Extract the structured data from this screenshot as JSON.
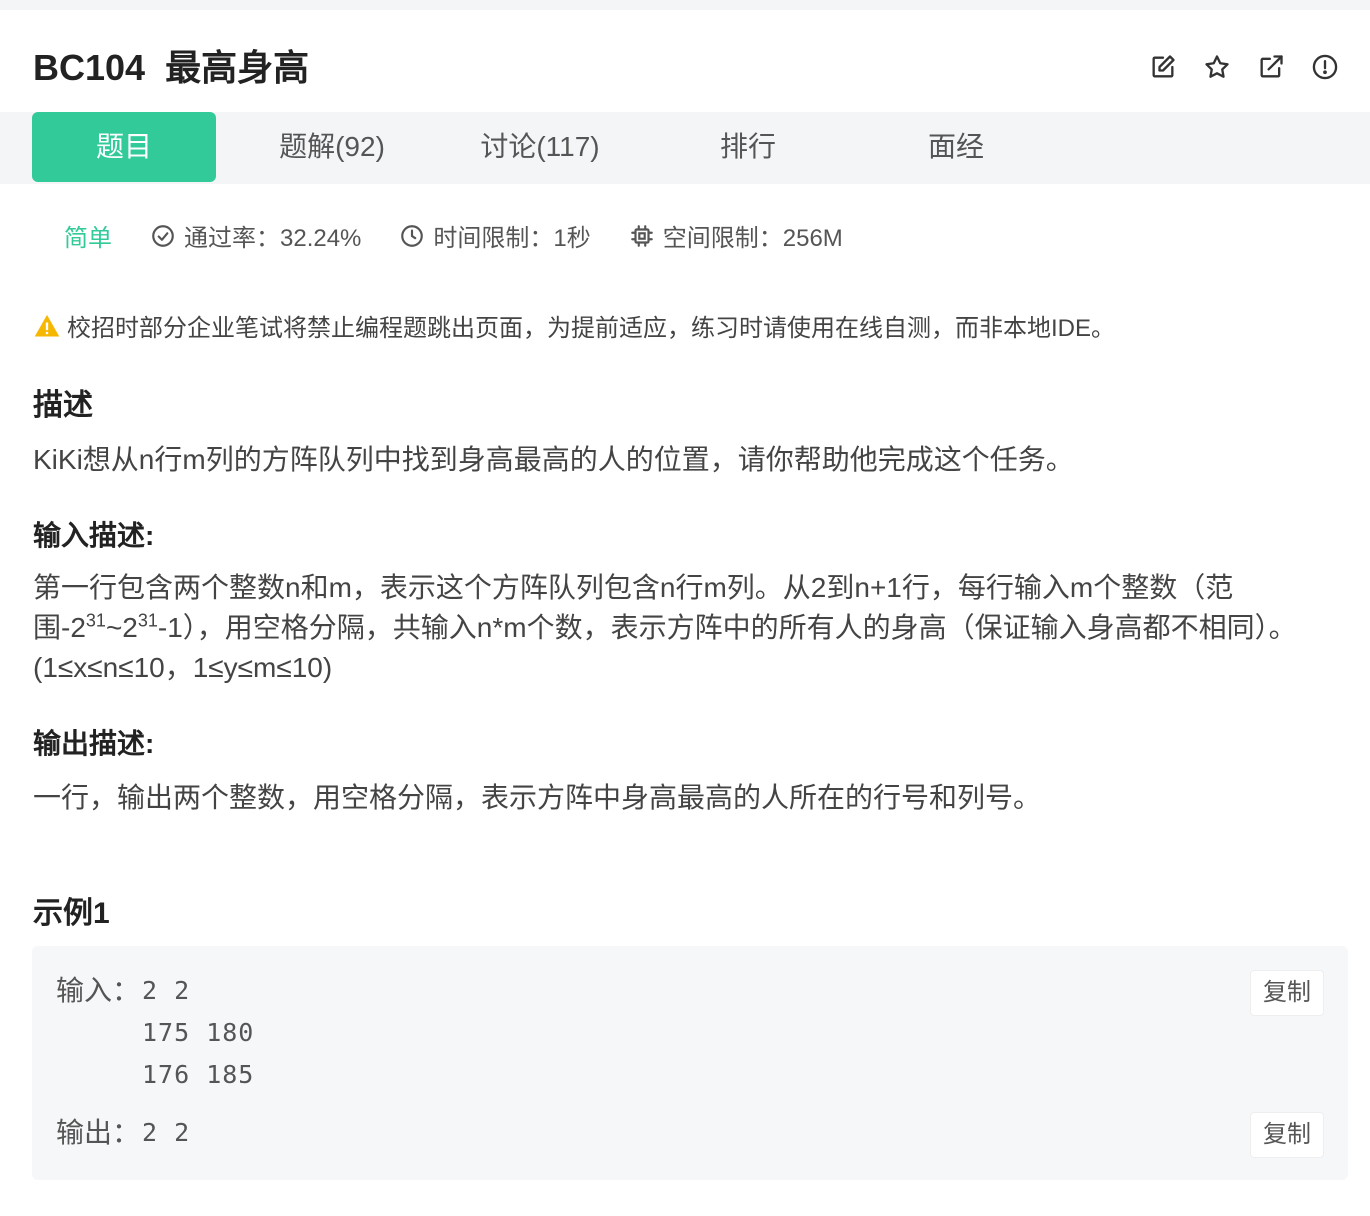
{
  "problem": {
    "id": "BC104",
    "title": "最高身高"
  },
  "actions": [
    {
      "name": "edit-icon"
    },
    {
      "name": "star-icon"
    },
    {
      "name": "share-icon"
    },
    {
      "name": "report-icon"
    }
  ],
  "tabs": [
    {
      "label": "题目",
      "active": true
    },
    {
      "label": "题解(92)",
      "active": false
    },
    {
      "label": "讨论(117)",
      "active": false
    },
    {
      "label": "排行",
      "active": false
    },
    {
      "label": "面经",
      "active": false
    }
  ],
  "meta": {
    "difficulty": "简单",
    "pass_rate": "通过率：32.24%",
    "time_limit": "时间限制：1秒",
    "space_limit": "空间限制：256M"
  },
  "warning": "校招时部分企业笔试将禁止编程题跳出页面，为提前适应，练习时请使用在线自测，而非本地IDE。",
  "description": {
    "heading": "描述",
    "text": "KiKi想从n行m列的方阵队列中找到身高最高的人的位置，请你帮助他完成这个任务。"
  },
  "input_desc": {
    "heading": "输入描述:",
    "line1": "第一行包含两个整数n和m，表示这个方阵队列包含n行m列。从2到n+1行，每行输入m个整数（范",
    "line2_a": "围-2",
    "line2_sup1": "31",
    "line2_b": "~2",
    "line2_sup2": "31",
    "line2_c": "-1），用空格分隔，共输入n*m个数，表示方阵中的所有人的身高（保证输入身高都不相同）。",
    "line3": "(1≤x≤n≤10，1≤y≤m≤10)"
  },
  "output_desc": {
    "heading": "输出描述:",
    "text": "一行，输出两个整数，用空格分隔，表示方阵中身高最高的人所在的行号和列号。"
  },
  "example": {
    "heading": "示例1",
    "input_label": "输入：",
    "input_lines": [
      "2 2",
      "175 180",
      "176 185"
    ],
    "output_label": "输出：",
    "output_lines": [
      "2 2"
    ],
    "copy_label": "复制"
  },
  "colors": {
    "accent": "#32ca99",
    "warning": "#f5b700"
  }
}
